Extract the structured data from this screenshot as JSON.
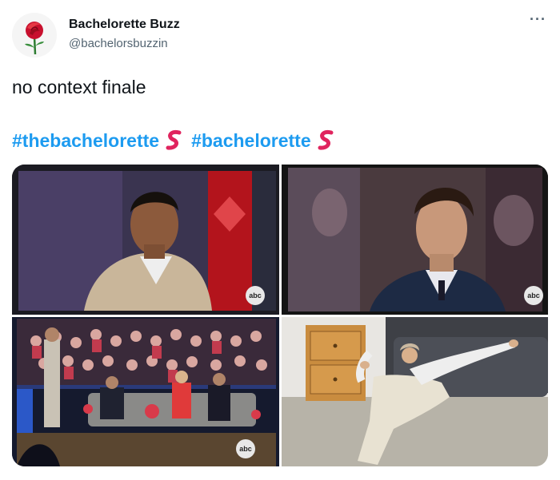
{
  "author": {
    "name": "Bachelorette Buzz",
    "handle": "@bachelorsbuzzin",
    "avatar_icon": "red-rose-icon"
  },
  "menu": {
    "more_label": "···"
  },
  "tweet": {
    "text": "no context finale",
    "hashtags": [
      "#thebachelorette",
      "#bachelorette"
    ]
  },
  "media": {
    "watermark": "abc",
    "panels": [
      {
        "description_icon": "tv-screen-man-beige-suit"
      },
      {
        "description_icon": "tv-screen-man-dark-suit"
      },
      {
        "description_icon": "tv-studio-audience"
      },
      {
        "description_icon": "woman-sliding-on-floor"
      }
    ]
  },
  "colors": {
    "link": "#1d9bf0",
    "text": "#0f1419",
    "secondary": "#536471",
    "hashflag": "#e0245e"
  }
}
